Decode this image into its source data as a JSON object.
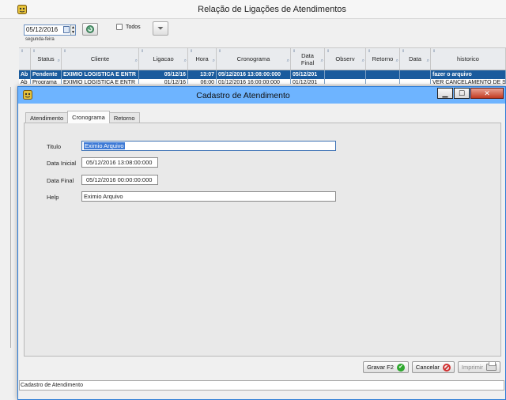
{
  "main_window": {
    "title": "Relação de Ligações de Atendimentos",
    "toolbar": {
      "date_value": "05/12/2016",
      "weekday": "segunda-feira",
      "todos_label": "Todos"
    },
    "grid": {
      "columns": [
        "",
        "Status",
        "Cliente",
        "Ligacao",
        "Hora",
        "Cronograma",
        "Data Final",
        "Observ",
        "Retorno",
        "Data",
        "historico"
      ],
      "rows": [
        [
          "Ab",
          "Pendente",
          "EXIMIO LOGISTICA E ENTR",
          "05/12/16",
          "13:07",
          "05/12/2016 13:08:00:000",
          "05/12/201",
          "",
          "",
          "",
          "fazer o arquivo"
        ],
        [
          "Ab",
          "Programa",
          "EXIMIO LOGISTICA E ENTR",
          "01/12/16",
          "06:00",
          "01/12/2016 16:00:00:000",
          "01/12/201",
          "",
          "",
          "",
          "VER CANCELAMENTO DE SE"
        ]
      ]
    }
  },
  "dialog": {
    "title": "Cadastro de Atendimento",
    "tabs": [
      "Atendimento",
      "Cronograma",
      "Retorno"
    ],
    "active_tab": "Cronograma",
    "fields": {
      "titulo": {
        "label": "Titulo",
        "value": "Eximio Arquivo"
      },
      "data_inicial": {
        "label": "Data Inicial",
        "value": "05/12/2016 13:08:00:000"
      },
      "data_final": {
        "label": "Data Final",
        "value": "05/12/2016 00:00:00:000"
      },
      "help": {
        "label": "Help",
        "value": "Eximio Arquivo"
      }
    },
    "buttons": {
      "gravar": "Gravar F2",
      "cancelar": "Cancelar",
      "imprimir": "Imprimir"
    },
    "status_text": "Cadastro de Atendimento"
  },
  "colors": {
    "dialog_titlebar": "#6eb4ff",
    "selected_row": "#1a5b9d",
    "close_button": "#c23b22",
    "text_selection": "#3d7ad6"
  }
}
